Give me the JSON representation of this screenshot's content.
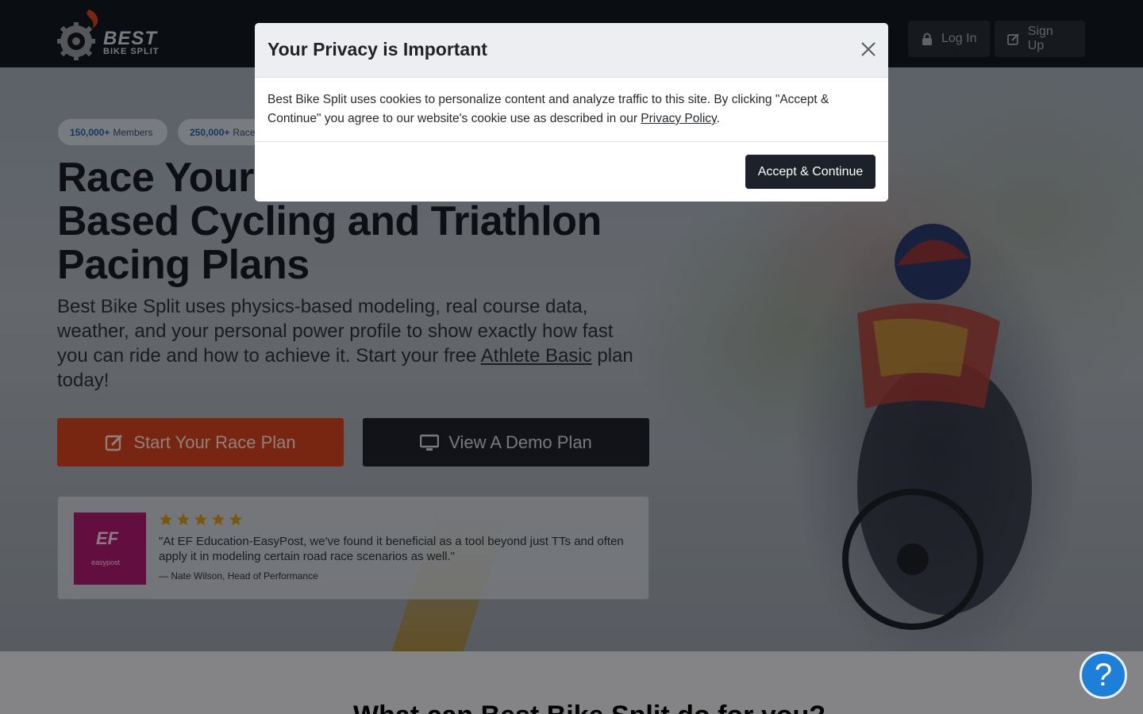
{
  "header": {
    "brand_line1": "BEST",
    "brand_line2": "BIKE SPLIT",
    "login_label": "Log In",
    "signup_label": "Sign Up"
  },
  "hero": {
    "badges": [
      {
        "value": "150,000+",
        "label": "Members"
      },
      {
        "value": "250,000+",
        "label": "Race"
      }
    ],
    "headline": "Race Your Best with Physics-Based Cycling and Triathlon Pacing Plans",
    "subtext_before": "Best Bike Split uses physics-based modeling, real course data, weather, and your personal power profile to show exactly how fast you can ride and how to achieve it. Start your free ",
    "subtext_link": "Athlete Basic",
    "subtext_after": " plan today!",
    "cta_primary": "Start Your Race Plan",
    "cta_secondary": "View A Demo Plan"
  },
  "testimonial": {
    "logo_text": "EF",
    "logo_sub": "easypost",
    "stars": 5,
    "quote": "\"At EF Education-EasyPost, we've found it beneficial as a tool beyond just TTs and often apply it in modeling certain road race scenarios as well.\"",
    "author": "— Nate Wilson, Head of Performance"
  },
  "modal": {
    "title": "Your Privacy is Important",
    "body_before": "Best Bike Split uses cookies to personalize content and analyze traffic to this site. By clicking \"Accept & Continue\" you agree to our website's cookie use as described in our ",
    "body_link": "Privacy Policy",
    "body_after": ".",
    "accept_label": "Accept & Continue"
  },
  "next_section": {
    "title": "What can Best Bike Split do for you?"
  },
  "help": {
    "label": "?"
  },
  "colors": {
    "accent_orange": "#c83e1f",
    "dark": "#1d212a",
    "help_blue": "#1e7fd8"
  }
}
